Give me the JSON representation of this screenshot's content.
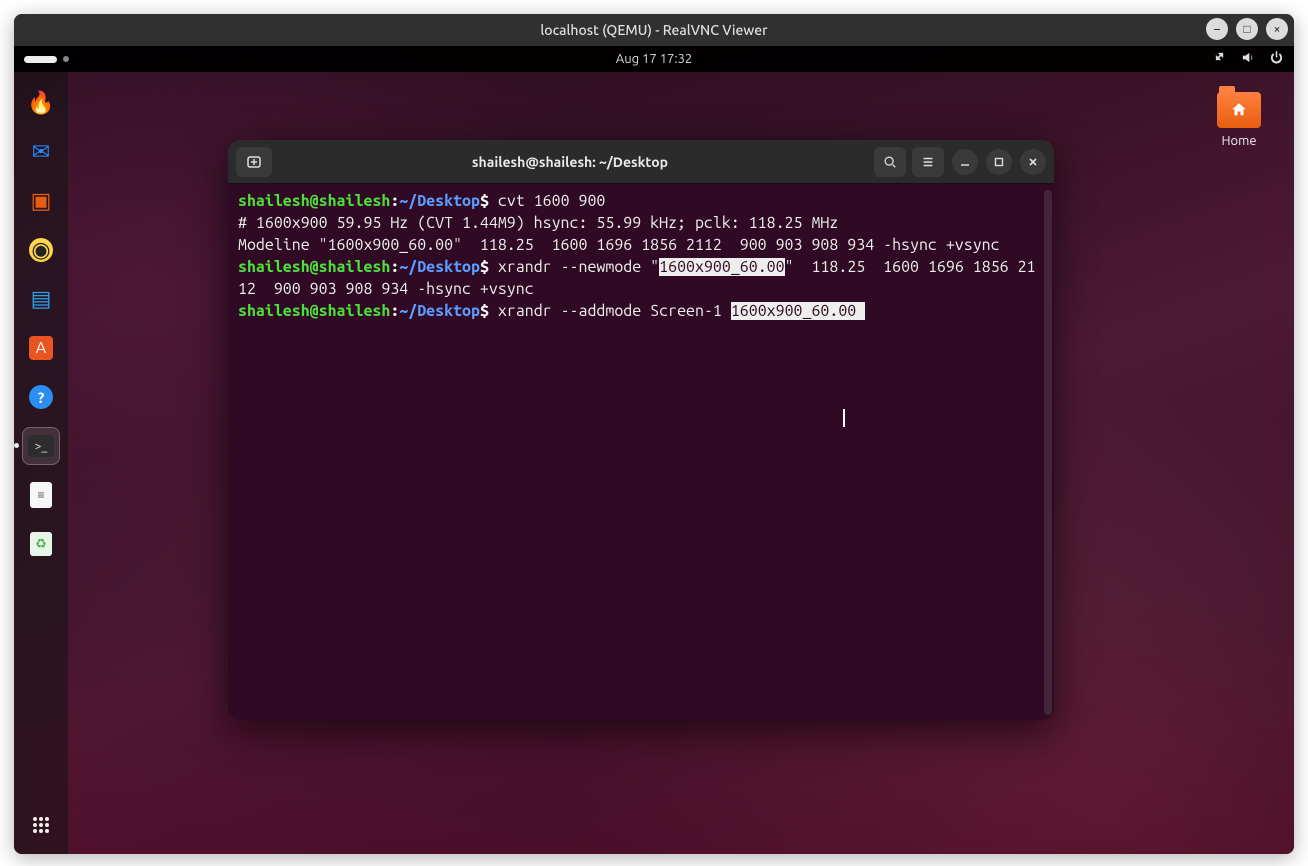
{
  "vnc": {
    "title": "localhost (QEMU) - RealVNC Viewer",
    "minimize": "–",
    "maximize": "□",
    "close": "×"
  },
  "topbar": {
    "datetime": "Aug 17  17:32"
  },
  "dock": {
    "items": [
      {
        "name": "firefox",
        "emoji": "🦊"
      },
      {
        "name": "thunderbird",
        "emoji": "🕊️"
      },
      {
        "name": "files",
        "emoji": "📁"
      },
      {
        "name": "rhythmbox",
        "emoji": "🎵"
      },
      {
        "name": "libreoffice-writer",
        "emoji": "📄"
      },
      {
        "name": "software",
        "emoji": "🛍️"
      },
      {
        "name": "help",
        "emoji": "❔"
      },
      {
        "name": "terminal",
        "emoji": "⌨️"
      },
      {
        "name": "text-editor",
        "emoji": "🗒️"
      },
      {
        "name": "trash",
        "emoji": "♻️"
      }
    ]
  },
  "home": {
    "label": "Home"
  },
  "terminal": {
    "title": "shailesh@shailesh: ~/Desktop",
    "prompt": {
      "userhost": "shailesh@shailesh",
      "path": "~/Desktop",
      "sigil": "$"
    },
    "lines": {
      "cmd1": " cvt 1600 900",
      "out1": "# 1600x900 59.95 Hz (CVT 1.44M9) hsync: 55.99 kHz; pclk: 118.25 MHz",
      "out2": "Modeline \"1600x900_60.00\"  118.25  1600 1696 1856 2112  900 903 908 934 -hsync +vsync",
      "cmd2a": " xrandr --newmode \"",
      "cmd2_hl": "1600x900_60.00",
      "cmd2b": "\"  118.25  1600 1696 1856 2112  900 903 908 934 -hsync +vsync",
      "cmd3a": " xrandr --addmode Screen-1 ",
      "cmd3_hl": "1600x900_60.00 "
    }
  }
}
